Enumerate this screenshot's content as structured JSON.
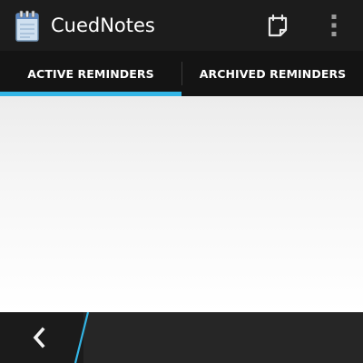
{
  "app": {
    "title": "CuedNotes",
    "icon": "notepad-icon"
  },
  "toolbar": {
    "calendar_icon": "calendar-icon",
    "overflow_icon": "more-vert-icon"
  },
  "tabs": [
    {
      "label": "ACTIVE REMINDERS",
      "selected": true
    },
    {
      "label": "ARCHIVED REMINDERS",
      "selected": false
    }
  ],
  "bottom_nav": {
    "back_icon": "chevron-left-icon"
  },
  "colors": {
    "accent": "#33b5e5",
    "action_bar": "#1c1c1c",
    "tab_bar": "#141414",
    "content_bg": "#ffffff",
    "bottom_bar": "#262626"
  }
}
